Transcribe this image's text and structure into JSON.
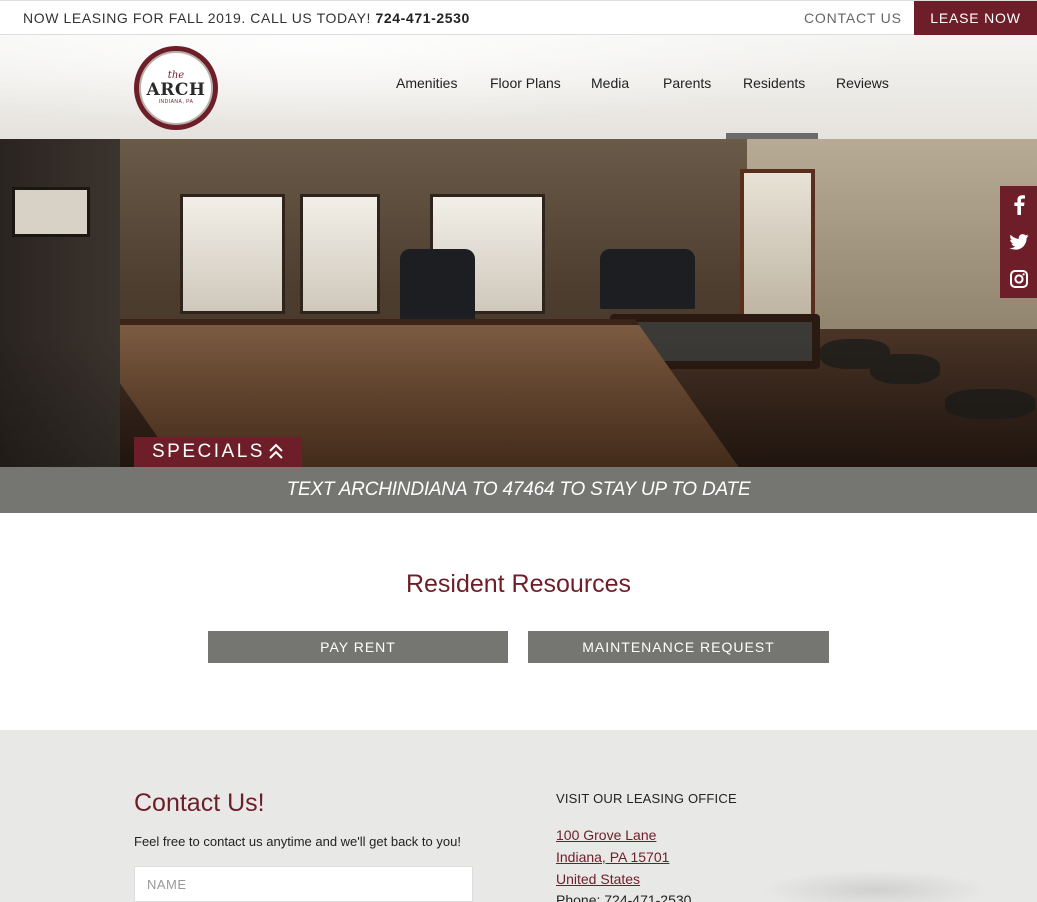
{
  "topbar": {
    "announcement": "NOW LEASING FOR FALL 2019. CALL US TODAY!",
    "phone": "724-471-2530",
    "contact_label": "CONTACT US",
    "lease_label": "LEASE NOW"
  },
  "logo": {
    "the": "the",
    "name": "ARCH",
    "location": "INDIANA, PA"
  },
  "nav": {
    "items": [
      "Amenities",
      "Floor Plans",
      "Media",
      "Parents",
      "Residents",
      "Reviews"
    ],
    "active": "Residents"
  },
  "hero": {
    "specials_label": "SPECIALS"
  },
  "social": {
    "icons": [
      "facebook-icon",
      "twitter-icon",
      "instagram-icon"
    ]
  },
  "textbar": "TEXT ARCHINDIANA TO 47464 TO STAY UP TO DATE",
  "resources": {
    "title": "Resident Resources",
    "buttons": [
      "PAY RENT",
      "MAINTENANCE REQUEST"
    ]
  },
  "contact": {
    "title": "Contact Us!",
    "subtitle": "Feel free to contact us anytime and we'll get back to you!",
    "name_placeholder": "NAME",
    "visit_heading": "VISIT OUR LEASING OFFICE",
    "address_lines": [
      "100 Grove Lane",
      "Indiana, PA 15701",
      "United States"
    ],
    "phone_line": "Phone: 724-471-2530"
  },
  "colors": {
    "brand": "#6e1e28",
    "gray": "#757672"
  }
}
